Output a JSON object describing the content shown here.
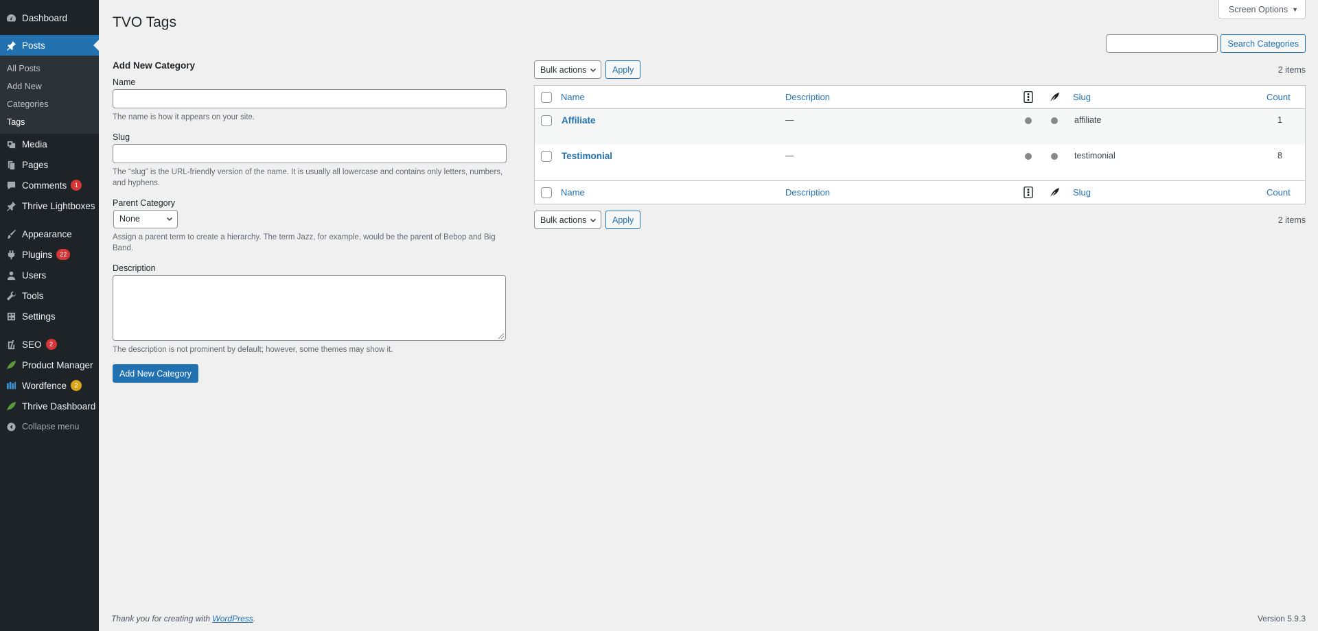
{
  "sidebar": {
    "dashboard": "Dashboard",
    "posts": "Posts",
    "posts_sub": [
      "All Posts",
      "Add New",
      "Categories",
      "Tags"
    ],
    "media": "Media",
    "pages": "Pages",
    "comments": "Comments",
    "comments_badge": "1",
    "thrive_lightboxes": "Thrive Lightboxes",
    "appearance": "Appearance",
    "plugins": "Plugins",
    "plugins_badge": "22",
    "users": "Users",
    "tools": "Tools",
    "settings": "Settings",
    "seo": "SEO",
    "seo_badge": "2",
    "product_manager": "Product Manager",
    "wordfence": "Wordfence",
    "wordfence_badge": "2",
    "thrive_dashboard": "Thrive Dashboard",
    "collapse": "Collapse menu"
  },
  "header": {
    "title": "TVO Tags",
    "screen_options": "Screen Options",
    "search_button": "Search Categories",
    "search_value": ""
  },
  "form": {
    "heading": "Add New Category",
    "name_label": "Name",
    "name_value": "",
    "name_help": "The name is how it appears on your site.",
    "slug_label": "Slug",
    "slug_value": "",
    "slug_help": "The “slug” is the URL-friendly version of the name. It is usually all lowercase and contains only letters, numbers, and hyphens.",
    "parent_label": "Parent Category",
    "parent_selected": "None",
    "parent_help": "Assign a parent term to create a hierarchy. The term Jazz, for example, would be the parent of Bebop and Big Band.",
    "description_label": "Description",
    "description_value": "",
    "description_help": "The description is not prominent by default; however, some themes may show it.",
    "submit": "Add New Category"
  },
  "table": {
    "bulk_actions": "Bulk actions",
    "apply": "Apply",
    "items_count": "2 items",
    "columns": {
      "name": "Name",
      "description": "Description",
      "slug": "Slug",
      "count": "Count"
    },
    "rows": [
      {
        "name": "Affiliate",
        "description": "—",
        "slug": "affiliate",
        "count": "1"
      },
      {
        "name": "Testimonial",
        "description": "—",
        "slug": "testimonial",
        "count": "8"
      }
    ]
  },
  "footer": {
    "thanks_prefix": "Thank you for creating with ",
    "thanks_link": "WordPress",
    "thanks_suffix": ".",
    "version": "Version 5.9.3"
  },
  "colors": {
    "sidebar_bg": "#1d2327",
    "accent": "#2271b1",
    "badge_red": "#d63638",
    "badge_orange": "#dba617",
    "page_bg": "#f0f0f1"
  }
}
